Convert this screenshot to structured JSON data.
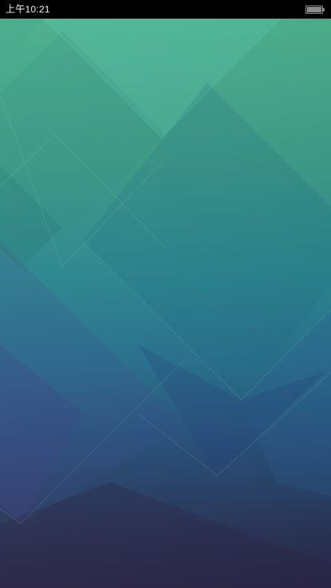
{
  "status_bar": {
    "time": "上午10:21",
    "battery_icon": "battery-icon",
    "battery_level": 1.0
  },
  "wallpaper": {
    "pattern": "geometric-diamond-facets",
    "colors": {
      "top": "#4aae8a",
      "upper_mid": "#2f8f8a",
      "mid": "#2a7597",
      "lower_mid": "#274b78",
      "bottom": "#2a2748"
    }
  }
}
